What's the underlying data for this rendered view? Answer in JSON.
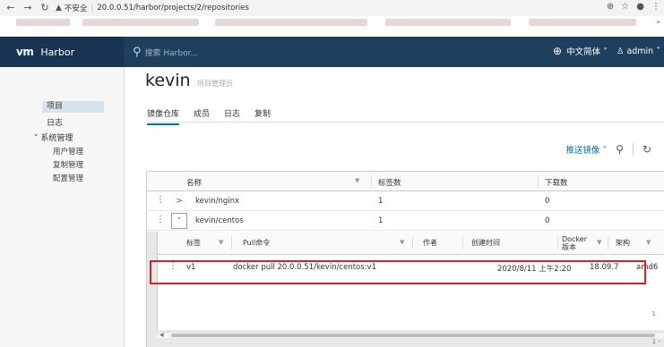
{
  "browser": {
    "security_label": "不安全",
    "url": "20.0.0.51/harbor/projects/2/repositories"
  },
  "header": {
    "brand": "vm",
    "app_name": "Harbor",
    "search_placeholder": "搜索 Harbor...",
    "language": "中文简体",
    "user": "admin"
  },
  "sidebar": {
    "items": [
      {
        "label": "项目"
      },
      {
        "label": "日志"
      }
    ],
    "group": {
      "label": "系统管理",
      "children": [
        {
          "label": "用户管理"
        },
        {
          "label": "复制管理"
        },
        {
          "label": "配置管理"
        }
      ]
    }
  },
  "project": {
    "name": "kevin",
    "role": "项目管理员"
  },
  "tabs": [
    {
      "label": "镜像仓库"
    },
    {
      "label": "成员"
    },
    {
      "label": "日志"
    },
    {
      "label": "复制"
    }
  ],
  "toolbar": {
    "push_label": "推送镜像"
  },
  "repo_table": {
    "columns": [
      "名称",
      "标签数",
      "下载数"
    ],
    "rows": [
      {
        "name": "kevin/nginx",
        "tags": "1",
        "pulls": "0"
      },
      {
        "name": "kevin/centos",
        "tags": "1",
        "pulls": "0"
      }
    ]
  },
  "tag_table": {
    "columns": [
      "标签",
      "Pull命令",
      "作者",
      "创建时间",
      "Docker 版本",
      "架构"
    ],
    "rows": [
      {
        "tag": "v1",
        "pull": "docker pull 20.0.0.51/kevin/centos:v1",
        "author": "",
        "created": "2020/8/11 上午2:20",
        "docker": "18.09.7",
        "arch": "amd6"
      }
    ],
    "footer": "1",
    "grid_footer": "1 -"
  }
}
